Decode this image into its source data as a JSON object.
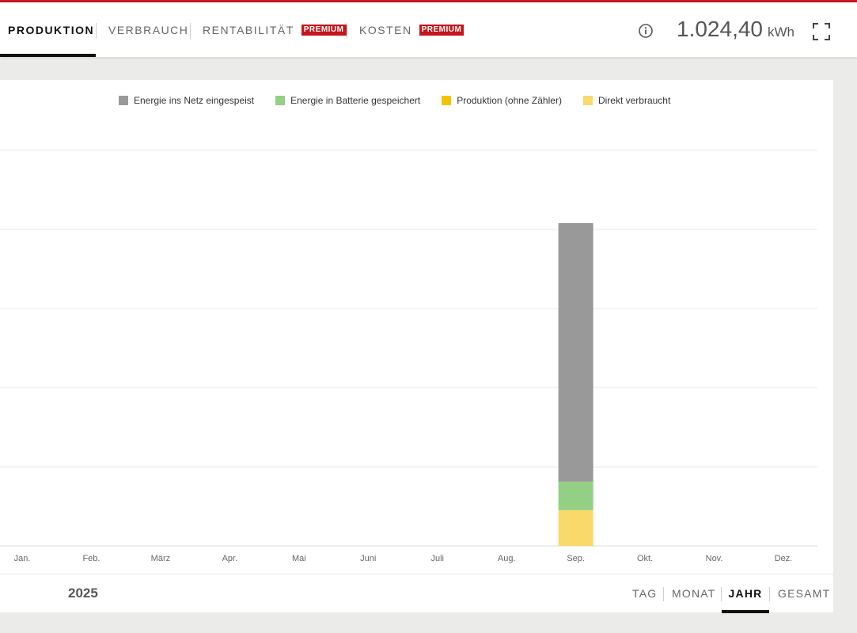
{
  "header": {
    "tabs": [
      {
        "label": "PRODUKTION",
        "active": true
      },
      {
        "label": "VERBRAUCH",
        "active": false
      },
      {
        "label": "RENTABILITÄT",
        "badge": "PREMIUM",
        "active": false
      },
      {
        "label": "KOSTEN",
        "badge": "PREMIUM",
        "active": false
      }
    ],
    "total_value": "1.024,40",
    "total_unit": "kWh",
    "info_icon": "info-icon",
    "expand_icon": "fullscreen-icon"
  },
  "colors": {
    "brand_red": "#c4161c",
    "grid": "#eaeaea",
    "axis_text": "#666666"
  },
  "chart_data": {
    "type": "bar",
    "stacked": true,
    "categories": [
      "Jan.",
      "Feb.",
      "März",
      "Apr.",
      "Mai",
      "Juni",
      "Juli",
      "Aug.",
      "Sep.",
      "Okt.",
      "Nov.",
      "Dez."
    ],
    "series": [
      {
        "name": "Direkt verbraucht",
        "color": "#f9d96a",
        "values": [
          0,
          0,
          0,
          0,
          0,
          0,
          0,
          0,
          113,
          0,
          0,
          0
        ]
      },
      {
        "name": "Energie in Batterie gespeichert",
        "color": "#93d083",
        "values": [
          0,
          0,
          0,
          0,
          0,
          0,
          0,
          0,
          90,
          0,
          0,
          0
        ]
      },
      {
        "name": "Produktion (ohne Zähler)",
        "color": "#f2c200",
        "values": [
          0,
          0,
          0,
          0,
          0,
          0,
          0,
          0,
          0,
          0,
          0,
          0
        ]
      },
      {
        "name": "Energie ins Netz eingespeist",
        "color": "#999999",
        "values": [
          0,
          0,
          0,
          0,
          0,
          0,
          0,
          0,
          817,
          0,
          0,
          0
        ]
      }
    ],
    "legend_order": [
      3,
      1,
      2,
      0
    ],
    "ylim": [
      0,
      1250
    ],
    "y_gridlines": [
      250,
      500,
      750,
      1000,
      1250
    ],
    "grid": true,
    "legend_position": "top"
  },
  "footer": {
    "year": "2025",
    "periods": [
      {
        "label": "TAG",
        "active": false
      },
      {
        "label": "MONAT",
        "active": false
      },
      {
        "label": "JAHR",
        "active": true
      },
      {
        "label": "GESAMT",
        "active": false
      }
    ]
  }
}
